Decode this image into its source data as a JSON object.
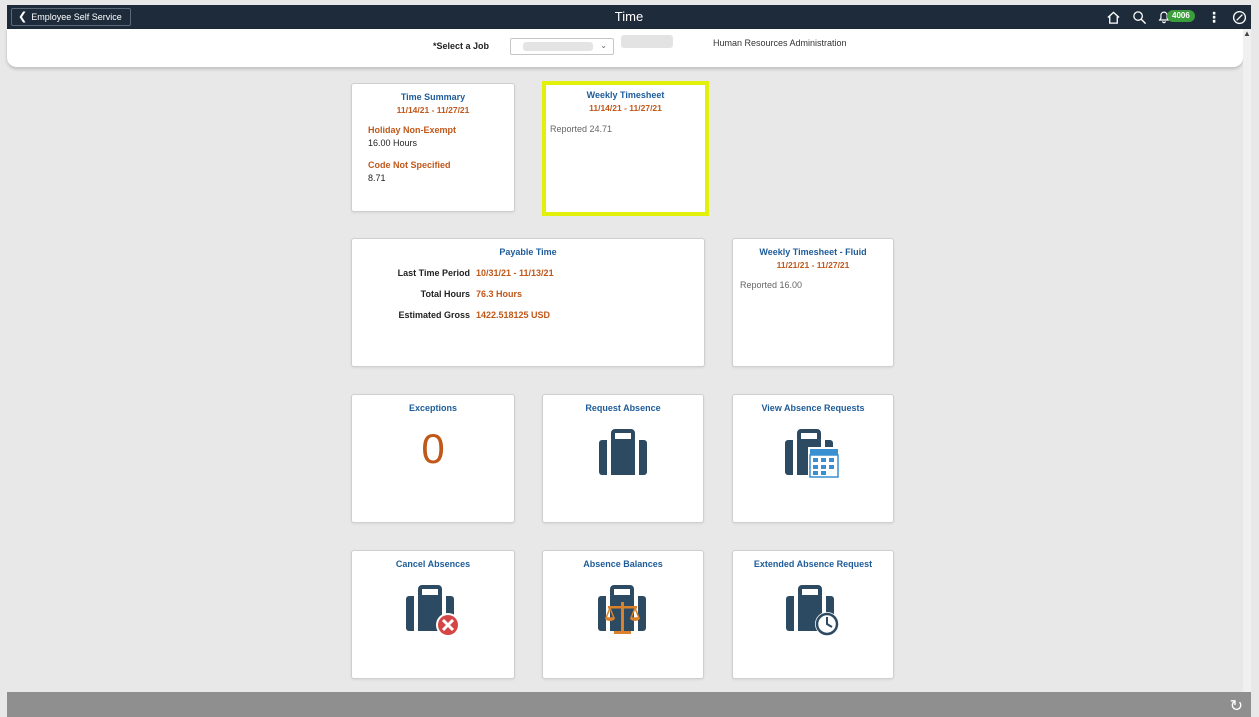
{
  "header": {
    "back_label": "Employee Self Service",
    "title": "Time",
    "notification_count": "4006"
  },
  "job": {
    "label": "*Select a Job",
    "department": "Human Resources Administration"
  },
  "tiles": {
    "time_summary": {
      "title": "Time Summary",
      "period": "11/14/21 - 11/27/21",
      "items": [
        {
          "label": "Holiday Non-Exempt",
          "value": "16.00 Hours"
        },
        {
          "label": "Code Not Specified",
          "value": "8.71"
        }
      ]
    },
    "weekly_timesheet": {
      "title": "Weekly Timesheet",
      "period": "11/14/21 - 11/27/21",
      "reported": "Reported 24.71"
    },
    "payable_time": {
      "title": "Payable Time",
      "rows": [
        {
          "label": "Last Time Period",
          "value": "10/31/21 - 11/13/21"
        },
        {
          "label": "Total Hours",
          "value": "76.3 Hours"
        },
        {
          "label": "Estimated Gross",
          "value": "1422.518125 USD"
        }
      ]
    },
    "weekly_timesheet_fluid": {
      "title": "Weekly Timesheet - Fluid",
      "period": "11/21/21 - 11/27/21",
      "reported": "Reported 16.00"
    },
    "exceptions": {
      "title": "Exceptions",
      "count": "0"
    },
    "request_absence": {
      "title": "Request Absence"
    },
    "view_absence_requests": {
      "title": "View Absence Requests"
    },
    "cancel_absences": {
      "title": "Cancel Absences"
    },
    "absence_balances": {
      "title": "Absence Balances"
    },
    "extended_absence_request": {
      "title": "Extended Absence Request"
    }
  },
  "colors": {
    "header_bg": "#1d2b3a",
    "tile_title": "#1e5c99",
    "accent_orange": "#c0581a",
    "highlight": "#e3f00a",
    "badge_green": "#3a9e3a"
  },
  "icons": [
    "chevron-left-icon",
    "home-icon",
    "search-icon",
    "bell-icon",
    "more-icon",
    "compass-icon",
    "briefcase-icon",
    "refresh-icon"
  ]
}
